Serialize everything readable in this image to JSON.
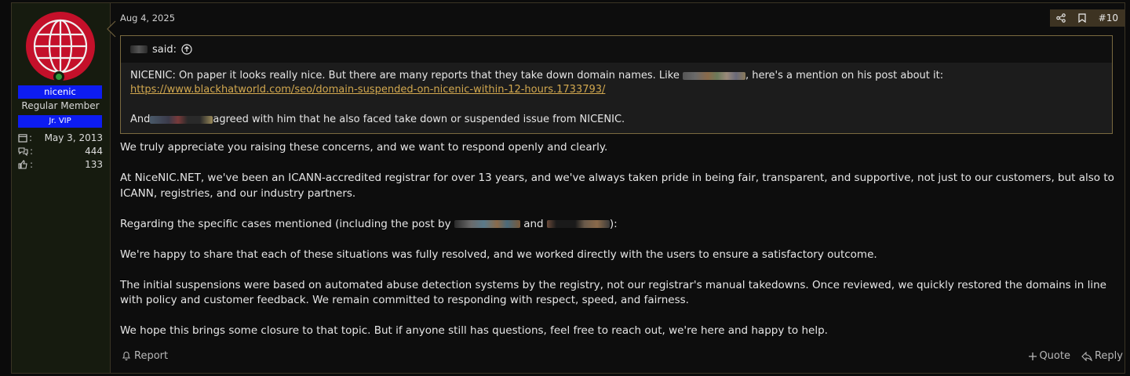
{
  "user": {
    "name": "nicenic",
    "title": "Regular Member",
    "banner": "Jr. VIP",
    "stats": {
      "joined": "May 3, 2013",
      "messages": "444",
      "reactions": "133"
    },
    "stat_icons": [
      "calendar-icon",
      "messages-icon",
      "thumbs-up-icon"
    ]
  },
  "post": {
    "date": "Aug 4, 2025",
    "number": "#10",
    "quote": {
      "said": "said:",
      "line1_before": "NICENIC: On paper it looks really nice. But there are many reports that they take down domain names. Like",
      "line1_after": ", here's a mention on his post about it:",
      "link": "https://www.blackhatworld.com/seo/domain-suspended-on-nicenic-within-12-hours.1733793/",
      "line2_before": "And",
      "line2_after": "agreed with him that he also faced take down or suspended issue from NICENIC."
    },
    "paragraphs": {
      "p1": "We truly appreciate you raising these concerns, and we want to respond openly and clearly.",
      "p2": "At NiceNIC.NET, we've been an ICANN-accredited registrar for over 13 years, and we've always taken pride in being fair, transparent, and supportive, not just to our customers, but also to ICANN, registries, and our industry partners.",
      "p3_before": "Regarding the specific cases mentioned (including the post by",
      "p3_mid": "and",
      "p3_after": "):",
      "p4": "We're happy to share that each of these situations was fully resolved, and we worked directly with the users to ensure a satisfactory outcome.",
      "p5": "The initial suspensions were based on automated abuse detection systems by the registry, not our registrar's manual takedowns. Once reviewed, we quickly restored the domains in line with policy and customer feedback. We remain committed to responding with respect, speed, and fairness.",
      "p6": "We hope this brings some closure to that topic. But if anyone still has questions, feel free to reach out, we're here and happy to help."
    },
    "footer": {
      "report": "Report",
      "quote": "Quote",
      "reply": "Reply"
    }
  },
  "colors": {
    "accent": "#d2a84f",
    "username_bg": "#0d1cf2",
    "avatar_red": "#c4102a",
    "online": "#2f9a3a"
  }
}
